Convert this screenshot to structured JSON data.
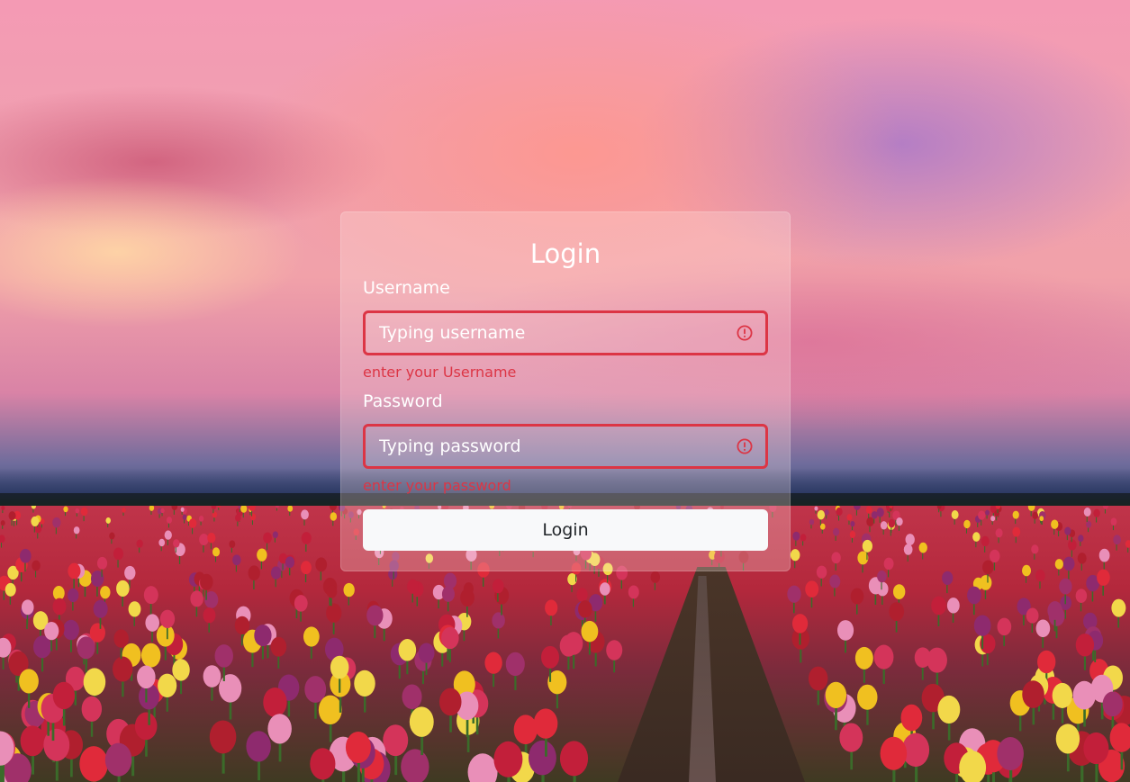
{
  "login_form": {
    "title": "Login",
    "username": {
      "label": "Username",
      "placeholder": "Typing username",
      "value": "",
      "error": "enter your Username"
    },
    "password": {
      "label": "Password",
      "placeholder": "Typing password",
      "value": "",
      "error": "enter your password"
    },
    "submit_label": "Login"
  },
  "colors": {
    "error": "#dc3545",
    "button_bg": "#f8f9fa",
    "button_text": "#212529",
    "heading_text": "#ffffff"
  },
  "icons": {
    "username_status": "exclamation-circle-icon",
    "password_status": "exclamation-circle-icon"
  }
}
